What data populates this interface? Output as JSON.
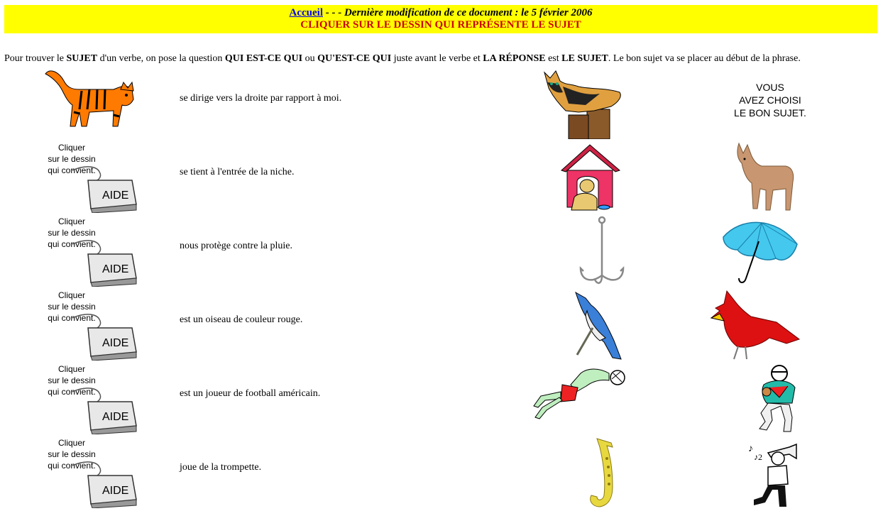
{
  "header": {
    "home_link": "Accueil",
    "modified_text": " - - - Dernière modification de ce document : le 5 février 2006",
    "instruction": "CLIQUER SUR LE DESSIN QUI REPRÉSENTE LE SUJET"
  },
  "intro": {
    "part1": "Pour trouver le ",
    "b1": "SUJET",
    "part2": " d'un verbe, on pose la question ",
    "b2": "QUI EST-CE QUI",
    "part3": " ou ",
    "b3": "QU'EST-CE QUI",
    "part4": " juste avant le verbe et ",
    "b4": "LA RÉPONSE",
    "part5": " est ",
    "b5": "LE SUJET",
    "part6": ". Le bon sujet va se placer au début de la phrase."
  },
  "help": {
    "line1": "Cliquer",
    "line2": "sur le dessin",
    "line3": "qui convient.",
    "button_label": "AIDE"
  },
  "feedback": {
    "line1": "VOUS",
    "line2": "AVEZ CHOISI",
    "line3": "LE BON SUJET."
  },
  "rows": [
    {
      "sentence": "se dirige vers la droite par rapport à moi.",
      "left_pic": "calico-cat-on-post",
      "right_pic": "answer-text"
    },
    {
      "sentence": "se tient à l'entrée de la niche.",
      "left_pic": "dog-in-doghouse",
      "right_pic": "brown-dog"
    },
    {
      "sentence": "nous protège contre la pluie.",
      "left_pic": "fishing-hook",
      "right_pic": "blue-umbrella"
    },
    {
      "sentence": "est un oiseau de couleur rouge.",
      "left_pic": "blue-jay",
      "right_pic": "red-cardinal"
    },
    {
      "sentence": "est un joueur de football américain.",
      "left_pic": "soccer-goalkeeper",
      "right_pic": "football-player"
    },
    {
      "sentence": "joue de la trompette.",
      "left_pic": "saxophone",
      "right_pic": "trumpet-player"
    }
  ],
  "colors": {
    "banner": "#ffff00",
    "link": "#0000ee",
    "instruction": "#cc0000"
  }
}
